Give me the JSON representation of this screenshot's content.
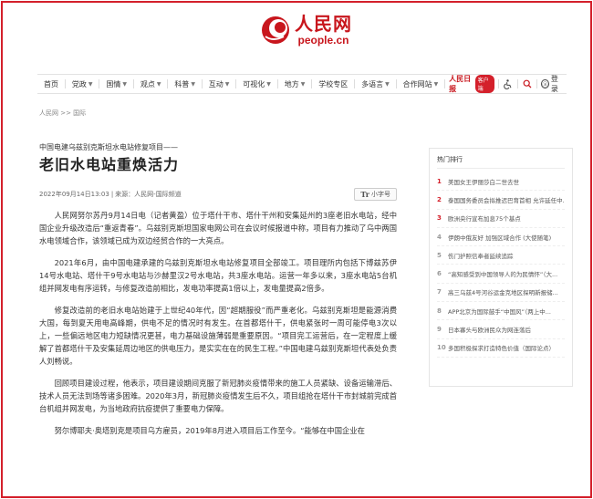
{
  "logo": {
    "name_cn": "人民网",
    "name_en": "people.cn",
    "brand_color": "#c8161d"
  },
  "nav": {
    "items": [
      {
        "label": "首页",
        "has_dropdown": false
      },
      {
        "label": "党政",
        "has_dropdown": true
      },
      {
        "label": "国情",
        "has_dropdown": true
      },
      {
        "label": "观点",
        "has_dropdown": true
      },
      {
        "label": "科普",
        "has_dropdown": true
      },
      {
        "label": "互动",
        "has_dropdown": true
      },
      {
        "label": "可视化",
        "has_dropdown": true
      },
      {
        "label": "地方",
        "has_dropdown": true
      },
      {
        "label": "学校专区",
        "has_dropdown": false
      },
      {
        "label": "多语言",
        "has_dropdown": true
      },
      {
        "label": "合作网站",
        "has_dropdown": true
      }
    ],
    "brand_label": "人民日报",
    "brand_pill": "客户端",
    "accessibility_icon": "wheelchair-icon",
    "search_icon": "search-icon",
    "login_label": "登录"
  },
  "breadcrumb": "人民网 >> 国际",
  "article": {
    "kicker": "中国电建乌兹别克斯坦水电站修复项目——",
    "title": "老旧水电站重焕活力",
    "date": "2022年09月14日13:03",
    "source": "来源：人民网-国际频道",
    "font_button": "小字号",
    "paragraphs": [
      "人民网努尔苏丹9月14日电（记者黄盈）位于塔什干市、塔什干州和安集延州的3座老旧水电站，经中国企业升级改造后“重返青春”。乌兹别克斯坦国家电网公司在会议时候报道中称，项目有力推动了乌中两国水电领域合作，该领域已成为双边经贸合作的一大亮点。",
      "2021年6月，由中国电建承建的乌兹别克斯坦水电站修复项目全部竣工。项目理所内包括下博兹苏伊14号水电站、塔什干9号水电站与沙赫里汉2号水电站，共3座水电站。运营一年多以来，3座水电站5台机组并网发电有序运转，与修复改造前相比，发电功率提高1倍以上，发电量提高2倍多。",
      "修复改造前的老旧水电站始建于上世纪40年代，因“超期服役”而严重老化。乌兹别克斯坦是能源消费大国，每到夏天用电高峰期，供电不足的情况时有发生。在首都塔什干，供电紧张时一周可能停电3次以上，一些偏远地区电力短缺情况更甚，电力基础设施薄弱是重要原因。“项目完工运营后，在一定程度上缓解了首都塔什干及安集延周边地区的供电压力，是实实在在的民生工程。”中国电建乌兹别克斯坦代表处负责人刘畅说。",
      "回顾项目建设过程，他表示，项目建设期间克服了新冠肺炎疫情带来的施工人员紧缺、设备运输滞后、技术人员无法到场等诸多困难。2020年3月，新冠肺炎疫情发生后不久，项目组抢在塔什干市封城前完成首台机组并网发电，为当地政府抗疫提供了重要电力保障。",
      "努尔博耶夫·奥塔别克是项目乌方雇员，2019年8月进入项目后工作至今。“能够在中国企业在"
    ]
  },
  "sidebar": {
    "title": "热门排行",
    "items": [
      {
        "rank": "1",
        "text": "美国女王伊丽莎白二世去世"
      },
      {
        "rank": "2",
        "text": "泰国国务委员会拟推迟巴育首相 允许延任中..."
      },
      {
        "rank": "3",
        "text": "欧洲央行宣布加息75个基点"
      },
      {
        "rank": "4",
        "text": "伊朗中俄友好 加强区域合作 (大使随笔)"
      },
      {
        "rank": "5",
        "text": "伤门护照信奉者延续追踪"
      },
      {
        "rank": "6",
        "text": "“高知感受到中国领导人的为民情怀”（大..."
      },
      {
        "rank": "7",
        "text": "高三乌兹4号河谷运金克地区探明新报储..."
      },
      {
        "rank": "8",
        "text": "APP北京为国际鼓手“中国风”（两上中..."
      },
      {
        "rank": "9",
        "text": "日本寡头与欧洲民众为网连落后"
      },
      {
        "rank": "10",
        "text": "多国积极探求打造特色价值（国际论点）"
      }
    ]
  },
  "colors": {
    "frame_border": "#d4202b",
    "accent_red": "#d4202b",
    "hot_rank": "#d4202b"
  }
}
